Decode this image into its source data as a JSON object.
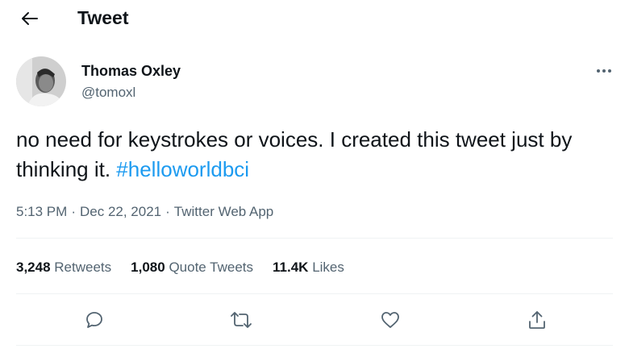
{
  "header": {
    "title": "Tweet",
    "back_icon": "arrow-left-icon"
  },
  "author": {
    "name": "Thomas Oxley",
    "handle": "@tomoxl"
  },
  "tweet": {
    "text": "no need for keystrokes or voices. I created this tweet just by thinking it. ",
    "hashtag": "#helloworldbci"
  },
  "meta": {
    "time": "5:13 PM",
    "date": "Dec 22, 2021",
    "source": "Twitter Web App",
    "separator": "·"
  },
  "stats": {
    "retweets": {
      "count": "3,248",
      "label": "Retweets"
    },
    "quote_tweets": {
      "count": "1,080",
      "label": "Quote Tweets"
    },
    "likes": {
      "count": "11.4K",
      "label": "Likes"
    }
  },
  "actions": [
    "reply-icon",
    "retweet-icon",
    "like-icon",
    "share-icon"
  ],
  "colors": {
    "text": "#0f1419",
    "secondary": "#536471",
    "link": "#1d9bf0",
    "divider": "#eff3f4"
  }
}
